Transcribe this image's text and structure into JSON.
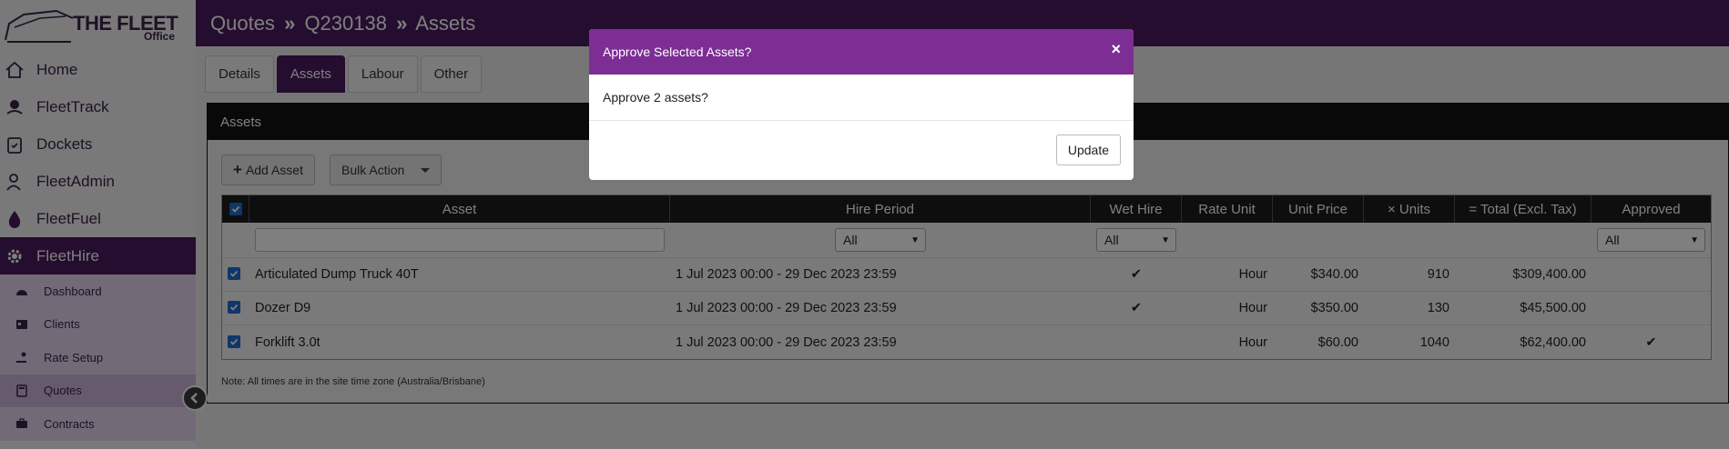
{
  "brand": {
    "name": "THE FLEET",
    "sub": "Office"
  },
  "nav": [
    {
      "label": "Home",
      "icon": "home-icon"
    },
    {
      "label": "FleetTrack",
      "icon": "location-icon"
    },
    {
      "label": "Dockets",
      "icon": "clipboard-icon"
    },
    {
      "label": "FleetAdmin",
      "icon": "users-icon"
    },
    {
      "label": "FleetFuel",
      "icon": "fuel-drop-icon"
    },
    {
      "label": "FleetHire",
      "icon": "gear-icon"
    }
  ],
  "subnav": [
    {
      "label": "Dashboard",
      "icon": "dashboard-icon"
    },
    {
      "label": "Clients",
      "icon": "id-card-icon"
    },
    {
      "label": "Rate Setup",
      "icon": "hand-coin-icon"
    },
    {
      "label": "Quotes",
      "icon": "calculator-icon"
    },
    {
      "label": "Contracts",
      "icon": "briefcase-icon"
    }
  ],
  "header": {
    "crumbs": [
      "Quotes",
      "Q230138",
      "Assets"
    ],
    "separator": "»"
  },
  "tabs": [
    "Details",
    "Assets",
    "Labour",
    "Other"
  ],
  "panel": {
    "title": "Assets",
    "add_label": "Add Asset",
    "bulk_label": "Bulk Action",
    "note": "Note: All times are in the site time zone (Australia/Brisbane)"
  },
  "table": {
    "columns": [
      "Asset",
      "Hire Period",
      "Wet Hire",
      "Rate Unit",
      "Unit Price",
      "× Units",
      "= Total (Excl. Tax)",
      "Approved"
    ],
    "filter_all": "All",
    "rows": [
      {
        "asset": "Articulated Dump Truck 40T",
        "period": "1 Jul 2023 00:00 - 29 Dec 2023 23:59",
        "wet_hire": "✔",
        "rate_unit": "Hour",
        "unit_price": "$340.00",
        "units": "910",
        "total": "$309,400.00",
        "approved": ""
      },
      {
        "asset": "Dozer D9",
        "period": "1 Jul 2023 00:00 - 29 Dec 2023 23:59",
        "wet_hire": "✔",
        "rate_unit": "Hour",
        "unit_price": "$350.00",
        "units": "130",
        "total": "$45,500.00",
        "approved": ""
      },
      {
        "asset": "Forklift 3.0t",
        "period": "1 Jul 2023 00:00 - 29 Dec 2023 23:59",
        "wet_hire": "",
        "rate_unit": "Hour",
        "unit_price": "$60.00",
        "units": "1040",
        "total": "$62,400.00",
        "approved": "✔"
      }
    ]
  },
  "modal": {
    "title": "Approve Selected Assets?",
    "body": "Approve 2 assets?",
    "button": "Update",
    "close": "×"
  },
  "colors": {
    "primary": "#4a1a5f",
    "modal_header": "#7d2e95",
    "table_header": "#1d1d1d"
  }
}
